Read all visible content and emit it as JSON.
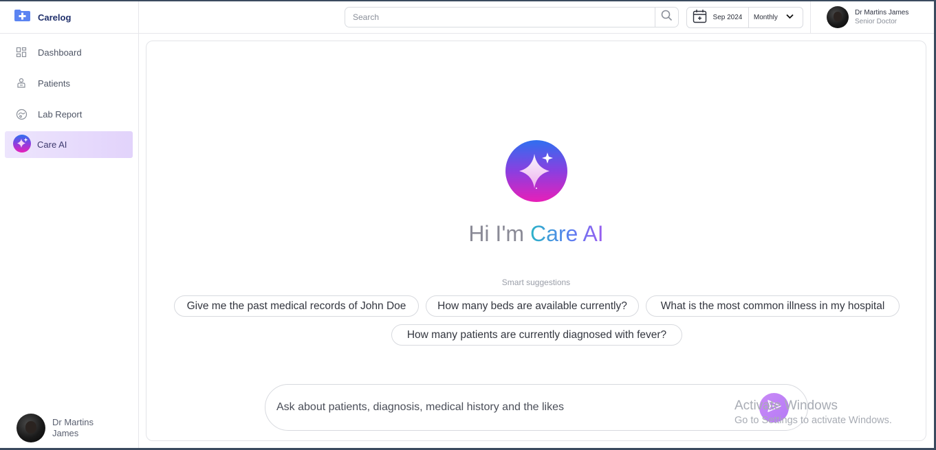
{
  "app": {
    "brand": "Carelog"
  },
  "sidebar": {
    "items": [
      {
        "label": "Dashboard",
        "icon": "dashboard-icon",
        "active": false
      },
      {
        "label": "Patients",
        "icon": "patients-icon",
        "active": false
      },
      {
        "label": "Lab Report",
        "icon": "lab-report-icon",
        "active": false
      },
      {
        "label": "Care AI",
        "icon": "care-ai-icon",
        "active": true
      }
    ],
    "user": {
      "name": "Dr Martins James"
    }
  },
  "topbar": {
    "search": {
      "placeholder": "Search",
      "value": ""
    },
    "date": {
      "label": "Sep 2024",
      "period": "Monthly"
    },
    "user": {
      "name": "Dr Martins James",
      "role": "Senior Doctor"
    }
  },
  "main": {
    "greeting_prefix": "Hi I'm ",
    "greeting_name": "Care AI",
    "suggestions_label": "Smart suggestions",
    "suggestions": [
      "Give me the past medical records of John Doe",
      "How many beds are available currently?",
      "What is the most common illness in my hospital",
      "How many patients are currently diagnosed with fever?"
    ],
    "composer": {
      "placeholder": "Ask about patients, diagnosis, medical history and the likes",
      "value": ""
    }
  },
  "watermark": {
    "title": "Activate Windows",
    "subtitle": "Go to Settings to activate Windows."
  },
  "colors": {
    "brand": "#4f7df0",
    "active_nav_bg": "#e6dafc",
    "ai_gradient_top": "#2f6ff0",
    "ai_gradient_bottom": "#e81fb8",
    "send_button": "#c38af7"
  }
}
